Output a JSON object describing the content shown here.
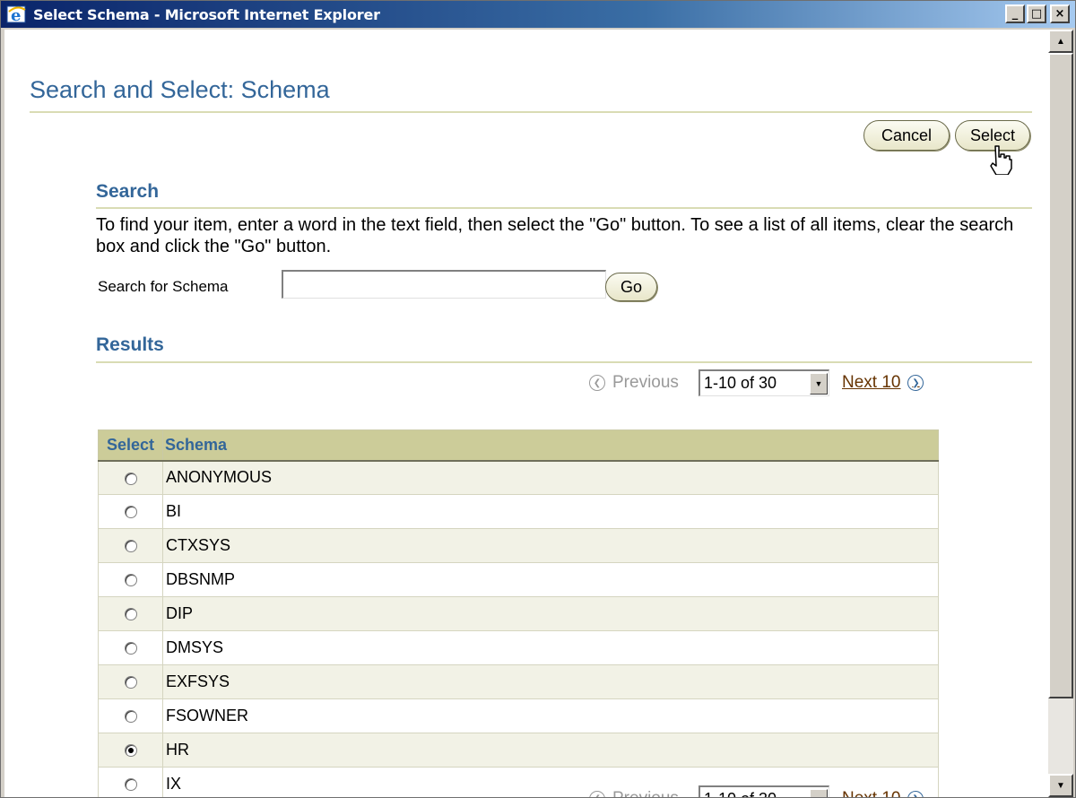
{
  "window": {
    "title": "Select Schema - Microsoft Internet Explorer",
    "buttons": {
      "minimize": "_",
      "maximize": "□",
      "close": "×"
    }
  },
  "page": {
    "title": "Search and Select: Schema",
    "cancel_label": "Cancel",
    "select_label": "Select"
  },
  "search": {
    "heading": "Search",
    "instructions": "To find your item, enter a word in the text field, then select the \"Go\" button. To see a list of all items, clear the search box and click the \"Go\" button.",
    "label": "Search for Schema",
    "value": "",
    "go_label": "Go"
  },
  "results": {
    "heading": "Results",
    "previous_label": "Previous",
    "range": "1-10 of 30",
    "next_label": "Next 10",
    "columns": [
      "Select",
      "Schema"
    ],
    "rows": [
      {
        "schema": "ANONYMOUS",
        "selected": false
      },
      {
        "schema": "BI",
        "selected": false
      },
      {
        "schema": "CTXSYS",
        "selected": false
      },
      {
        "schema": "DBSNMP",
        "selected": false
      },
      {
        "schema": "DIP",
        "selected": false
      },
      {
        "schema": "DMSYS",
        "selected": false
      },
      {
        "schema": "EXFSYS",
        "selected": false
      },
      {
        "schema": "FSOWNER",
        "selected": false
      },
      {
        "schema": "HR",
        "selected": true
      },
      {
        "schema": "IX",
        "selected": false
      }
    ]
  },
  "colors": {
    "accent_blue": "#336699",
    "header_tan": "#cccc99",
    "row_alt": "#f2f2e6",
    "link_brown": "#663300",
    "rule": "#d9dcb4"
  },
  "icons": [
    "ie-icon",
    "hand-cursor-icon",
    "previous-icon",
    "next-icon",
    "dropdown-arrow-icon",
    "scroll-up-icon",
    "scroll-down-icon"
  ]
}
